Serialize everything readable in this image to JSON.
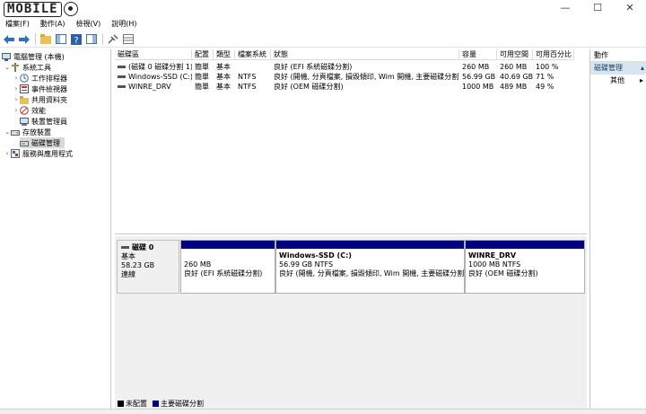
{
  "window": {
    "logo_text": "MOBILE",
    "min_glyph": "—",
    "max_glyph": "☐",
    "close_glyph": "✕"
  },
  "menu": [
    "檔案(F)",
    "動作(A)",
    "檢視(V)",
    "說明(H)"
  ],
  "tree": [
    {
      "label": "電腦管理 (本機)",
      "level": 0,
      "chev": ""
    },
    {
      "label": "系統工具",
      "level": 1,
      "chev": "⌄"
    },
    {
      "label": "工作排程器",
      "level": 2,
      "chev": "›"
    },
    {
      "label": "事件檢視器",
      "level": 2,
      "chev": "›"
    },
    {
      "label": "共用資料夾",
      "level": 2,
      "chev": "›"
    },
    {
      "label": "效能",
      "level": 2,
      "chev": "›"
    },
    {
      "label": "裝置管理員",
      "level": 2,
      "chev": ""
    },
    {
      "label": "存放裝置",
      "level": 1,
      "chev": "⌄"
    },
    {
      "label": "磁碟管理",
      "level": 2,
      "chev": ""
    },
    {
      "label": "服務與應用程式",
      "level": 1,
      "chev": "›"
    }
  ],
  "list": {
    "headers": [
      "磁碟區",
      "配置",
      "類型",
      "檔案系統",
      "狀態",
      "容量",
      "可用空間",
      "可用百分比"
    ],
    "rows": [
      [
        "(磁碟 0 磁碟分割 1)",
        "簡單",
        "基本",
        "",
        "良好 (EFI 系統磁碟分割)",
        "260 MB",
        "260 MB",
        "100 %"
      ],
      [
        "Windows-SSD (C:)",
        "簡單",
        "基本",
        "NTFS",
        "良好 (開機, 分頁檔案, 損毀傾印, Wim 開機, 主要磁碟分割)",
        "56.99 GB",
        "40.69 GB",
        "71 %"
      ],
      [
        "WINRE_DRV",
        "簡單",
        "基本",
        "NTFS",
        "良好 (OEM 磁碟分割)",
        "1000 MB",
        "489 MB",
        "49 %"
      ]
    ]
  },
  "disk": {
    "name": "磁碟 0",
    "type": "基本",
    "size": "58.23 GB",
    "status": "連線"
  },
  "partitions": [
    {
      "name": "",
      "size": "260 MB",
      "status": "良好 (EFI 系統磁碟分割)"
    },
    {
      "name": "Windows-SSD  (C:)",
      "size": "56.99 GB NTFS",
      "status": "良好 (開機, 分頁檔案, 損毀傾印, Wim 開機, 主要磁碟分割)"
    },
    {
      "name": "WINRE_DRV",
      "size": "1000 MB NTFS",
      "status": "良好 (OEM 磁碟分割)"
    }
  ],
  "legend": [
    {
      "label": "未配置",
      "color": "#000000"
    },
    {
      "label": "主要磁碟分割",
      "color": "#00007f"
    }
  ],
  "actions": {
    "header": "動作",
    "section": "磁碟管理",
    "item": "其他"
  }
}
